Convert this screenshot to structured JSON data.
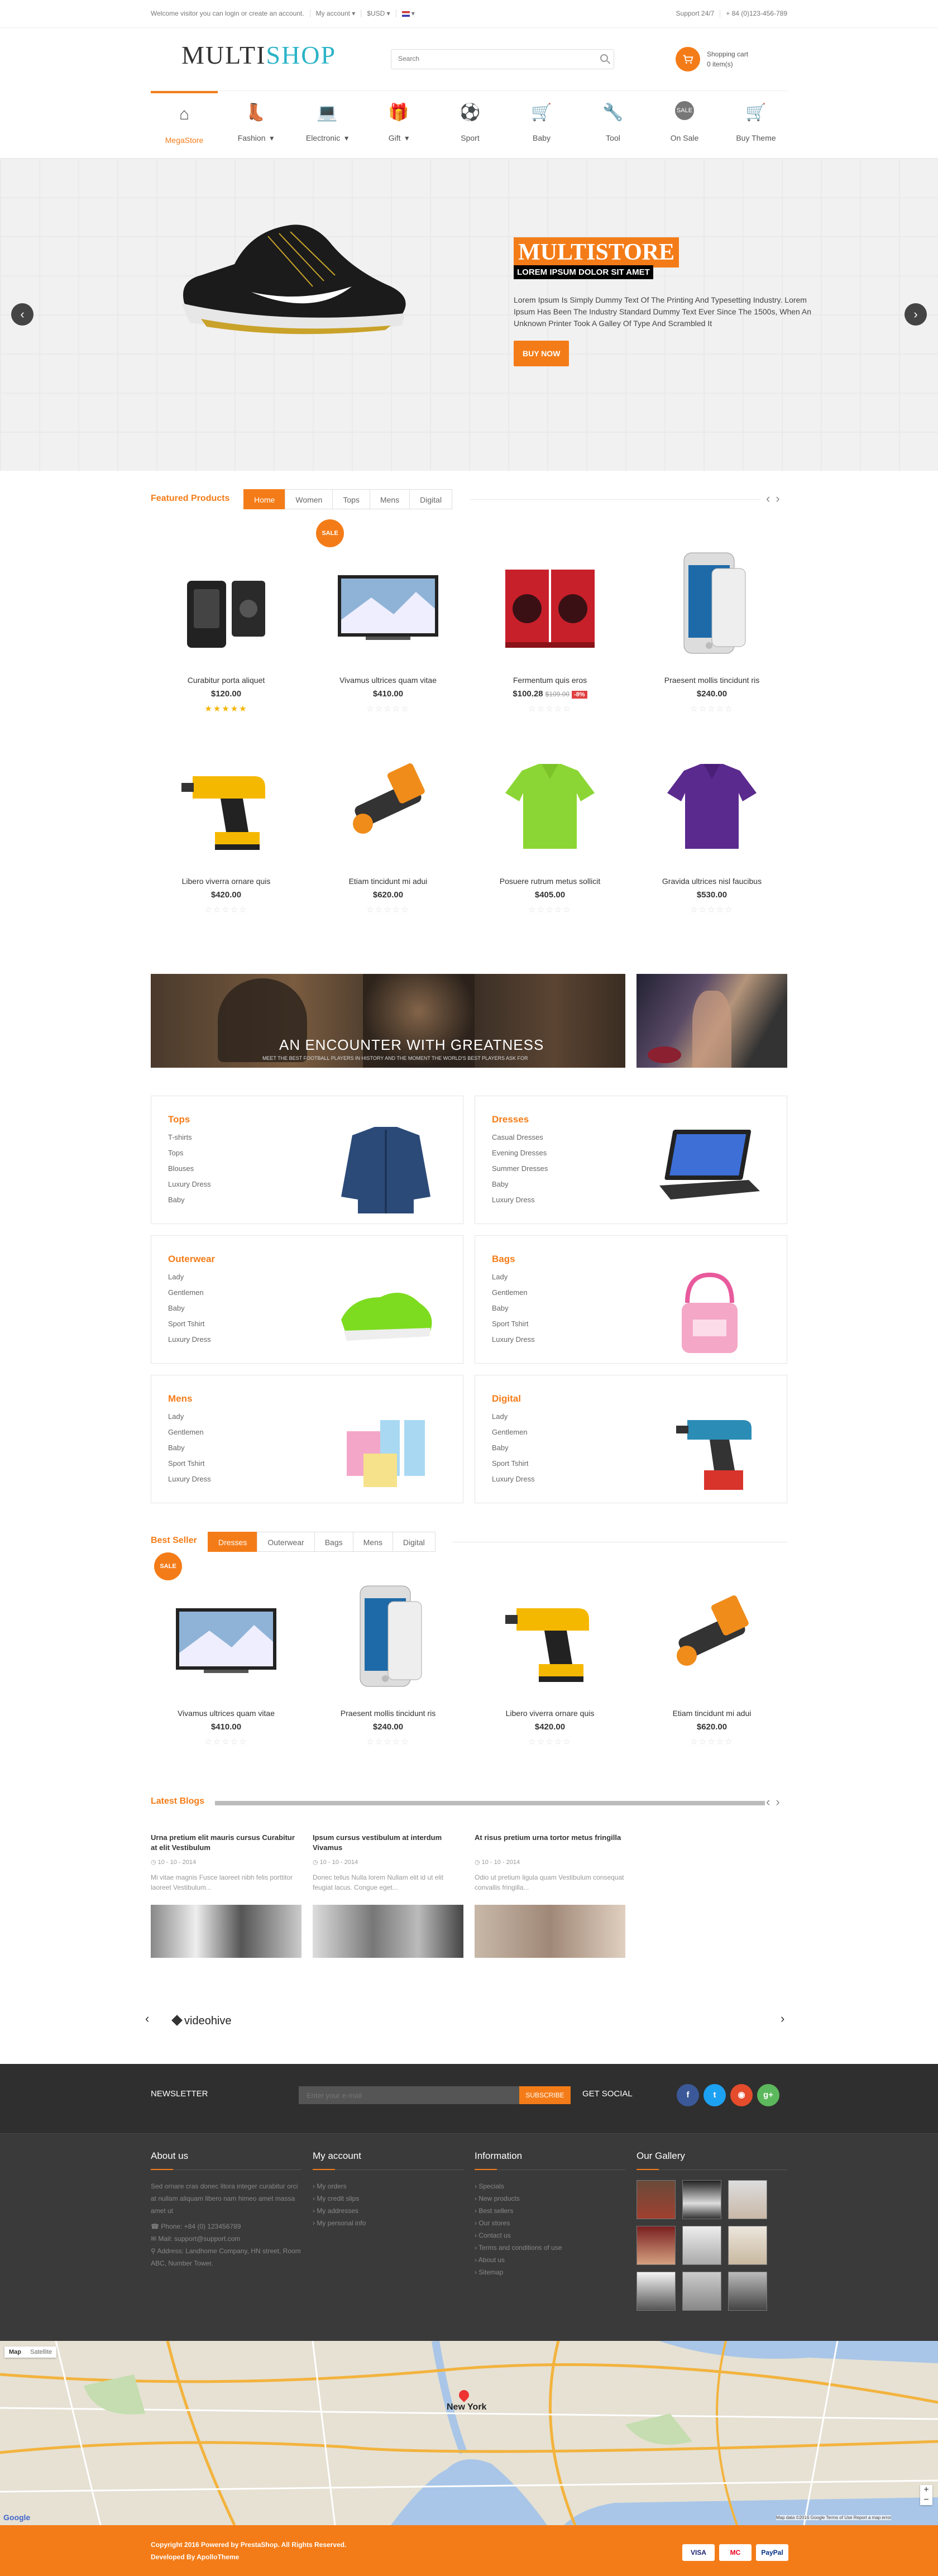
{
  "topbar": {
    "welcome": "Welcome visitor you can login or create an account.",
    "account": "My account ▾",
    "currency": "$USD ▾",
    "language": "▾",
    "support": "Support 24/7",
    "phone": "+ 84 (0)123-456-789"
  },
  "header": {
    "logo_a": "MULTI",
    "logo_b": "SHOP",
    "search_placeholder": "Search",
    "cart_title": "Shopping cart",
    "cart_count": "0 item(s)"
  },
  "nav": [
    {
      "label": "MegaStore",
      "icon": "⌂",
      "icon_name": "home-icon",
      "active": true,
      "caret": false
    },
    {
      "label": "Fashion",
      "icon": "👢",
      "icon_name": "boot-icon",
      "caret": true
    },
    {
      "label": "Electronic",
      "icon": "💻",
      "icon_name": "laptop-icon",
      "caret": true
    },
    {
      "label": "Gift",
      "icon": "🎁",
      "icon_name": "gift-icon",
      "caret": true
    },
    {
      "label": "Sport",
      "icon": "⚽",
      "icon_name": "ball-icon",
      "caret": false
    },
    {
      "label": "Baby",
      "icon": "🛒",
      "icon_name": "stroller-icon",
      "caret": false
    },
    {
      "label": "Tool",
      "icon": "🔧",
      "icon_name": "drill-icon",
      "caret": false
    },
    {
      "label": "On Sale",
      "icon": "SALE",
      "icon_name": "sale-icon",
      "caret": false
    },
    {
      "label": "Buy Theme",
      "icon": "🛒",
      "icon_name": "cart-icon",
      "caret": false
    }
  ],
  "slider": {
    "title": "MULTISTORE",
    "subtitle": "LOREM IPSUM DOLOR SIT AMET",
    "text": "Lorem Ipsum Is Simply Dummy Text Of The Printing And Typesetting Industry. Lorem Ipsum Has Been The Industry Standard Dummy Text Ever Since The 1500s, When An Unknown Printer Took A Galley Of Type And Scrambled It",
    "button": "BUY NOW",
    "prev": "‹",
    "next": "›"
  },
  "featured": {
    "title": "Featured Products",
    "tabs": [
      "Home",
      "Women",
      "Tops",
      "Mens",
      "Digital"
    ],
    "products": [
      {
        "name": "Curabitur porta aliquet",
        "price": "$120.00",
        "rating": 5,
        "img": "speaker"
      },
      {
        "name": "Vivamus ultrices quam vitae",
        "price": "$410.00",
        "rating": 0,
        "img": "tv",
        "sale": "SALE"
      },
      {
        "name": "Fermentum quis eros",
        "price": "$100.28",
        "old": "$109.00",
        "discount": "-8%",
        "rating": 0,
        "img": "washer"
      },
      {
        "name": "Praesent mollis tincidunt ris",
        "price": "$240.00",
        "rating": 0,
        "img": "phone"
      },
      {
        "name": "Libero viverra ornare quis",
        "price": "$420.00",
        "rating": 0,
        "img": "drill"
      },
      {
        "name": "Etiam tincidunt mi adui",
        "price": "$620.00",
        "rating": 0,
        "img": "flash"
      },
      {
        "name": "Posuere rutrum metus sollicit",
        "price": "$405.00",
        "rating": 0,
        "img": "polo-green"
      },
      {
        "name": "Gravida ultrices nisl faucibus",
        "price": "$530.00",
        "rating": 0,
        "img": "polo-purple"
      }
    ]
  },
  "banner": {
    "headline": "AN ENCOUNTER WITH GREATNESS",
    "sub": "MEET THE BEST FOOTBALL PLAYERS IN HISTORY AND THE MOMENT THE WORLD'S BEST PLAYERS ASK FOR"
  },
  "categories": [
    {
      "title": "Tops",
      "items": [
        "T-shirts",
        "Tops",
        "Blouses",
        "Luxury Dress",
        "Baby"
      ],
      "img": "jacket"
    },
    {
      "title": "Dresses",
      "items": [
        "Casual Dresses",
        "Evening Dresses",
        "Summer Dresses",
        "Baby",
        "Luxury Dress"
      ],
      "img": "laptop"
    },
    {
      "title": "Outerwear",
      "items": [
        "Lady",
        "Gentlemen",
        "Baby",
        "Sport Tshirt",
        "Luxury Dress"
      ],
      "img": "shoe"
    },
    {
      "title": "Bags",
      "items": [
        "Lady",
        "Gentlemen",
        "Baby",
        "Sport Tshirt",
        "Luxury Dress"
      ],
      "img": "bag"
    },
    {
      "title": "Mens",
      "items": [
        "Lady",
        "Gentlemen",
        "Baby",
        "Sport Tshirt",
        "Luxury Dress"
      ],
      "img": "gifts"
    },
    {
      "title": "Digital",
      "items": [
        "Lady",
        "Gentlemen",
        "Baby",
        "Sport Tshirt",
        "Luxury Dress"
      ],
      "img": "drill2"
    }
  ],
  "bestseller": {
    "title": "Best Seller",
    "tabs": [
      "Dresses",
      "Outerwear",
      "Bags",
      "Mens",
      "Digital"
    ],
    "products": [
      {
        "name": "Vivamus ultrices quam vitae",
        "price": "$410.00",
        "img": "tv",
        "sale": "SALE"
      },
      {
        "name": "Praesent mollis tincidunt ris",
        "price": "$240.00",
        "img": "phone"
      },
      {
        "name": "Libero viverra ornare quis",
        "price": "$420.00",
        "img": "drill"
      },
      {
        "name": "Etiam tincidunt mi adui",
        "price": "$620.00",
        "img": "flash"
      }
    ]
  },
  "blogs": {
    "title": "Latest Blogs",
    "items": [
      {
        "title": "Urna pretium elit mauris cursus Curabitur at elit Vestibulum",
        "date": "◷ 10 - 10 - 2014",
        "excerpt": "Mi vitae magnis Fusce laoreet nibh felis porttitor laoreet Vestibulum..."
      },
      {
        "title": "Ipsum cursus vestibulum at interdum Vivamus",
        "date": "◷ 10 - 10 - 2014",
        "excerpt": "Donec tellus Nulla lorem Nullam elit id ut elit feugiat lacus. Congue eget..."
      },
      {
        "title": "At risus pretium urna tortor metus fringilla",
        "date": "◷ 10 - 10 - 2014",
        "excerpt": "Odio ut pretium ligula quam Vestibulum consequat convallis fringilla..."
      }
    ]
  },
  "brand": {
    "name": "videohive",
    "prev": "‹",
    "next": "›"
  },
  "newsletter": {
    "label": "NEWSLETTER",
    "placeholder": "Enter your e-mail",
    "button": "SUBSCRIBE",
    "social_label": "GET SOCIAL",
    "social": [
      {
        "glyph": "f",
        "color": "#3b5998",
        "name": "facebook-icon"
      },
      {
        "glyph": "t",
        "color": "#1da1f2",
        "name": "twitter-icon"
      },
      {
        "glyph": "◉",
        "color": "#e44c2c",
        "name": "rss-icon"
      },
      {
        "glyph": "g+",
        "color": "#5cb85c",
        "name": "google-plus-icon"
      }
    ]
  },
  "footer": {
    "about_title": "About us",
    "about_text": "Sed ornare cras donec litora integer curabitur orci at nullam aliquam libero nam himeo amet massa amet ut",
    "phone": "☎  Phone: +84 (0) 123456789",
    "mail": "✉  Mail: support@support.com",
    "address": "⚲  Address: Landhome Company, HN street, Room ABC, Number Tower.",
    "account_title": "My account",
    "account_links": [
      "› My orders",
      "› My credit slips",
      "› My addresses",
      "› My personal info"
    ],
    "info_title": "Information",
    "info_links": [
      "› Specials",
      "› New products",
      "› Best sellers",
      "› Our stores",
      "› Contact us",
      "› Terms and conditions of use",
      "› About us",
      "› Sitemap"
    ],
    "gallery_title": "Our Gallery"
  },
  "map": {
    "tab1": "Map",
    "tab2": "Satellite",
    "city": "New York",
    "google": "Google",
    "credit": "Map data ©2016 Google   Terms of Use   Report a map error"
  },
  "bottom": {
    "copyright": "Copyright 2016 Powered by PrestaShop. All Rights Reserved.",
    "developer": "Developed By ApolloTheme",
    "payments": [
      "VISA",
      "MC",
      "PayPal"
    ]
  },
  "colors": {
    "accent": "#f47c18",
    "dark": "#3a3a3a"
  }
}
